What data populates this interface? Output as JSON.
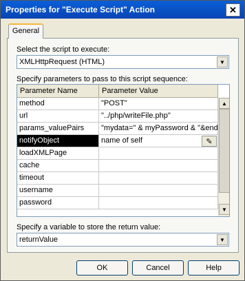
{
  "window": {
    "title": "Properties for \"Execute Script\" Action"
  },
  "tabs": [
    {
      "label": "General"
    }
  ],
  "script": {
    "label": "Select the script to execute:",
    "value": "XMLHttpRequest (HTML)"
  },
  "params": {
    "label": "Specify parameters to pass to this script sequence:",
    "headers": [
      "Parameter Name",
      "Parameter Value"
    ],
    "rows": [
      {
        "name": "method",
        "value": "\"POST\""
      },
      {
        "name": "url",
        "value": "\"../php/writeFile.php\""
      },
      {
        "name": "params_valuePairs",
        "value": "\"mydata=\" & myPassword & \"&end"
      },
      {
        "name": "notifyObject",
        "value": "name of self",
        "selected": true
      },
      {
        "name": "loadXMLPage",
        "value": ""
      },
      {
        "name": "cache",
        "value": ""
      },
      {
        "name": "timeout",
        "value": ""
      },
      {
        "name": "username",
        "value": ""
      },
      {
        "name": "password",
        "value": ""
      }
    ]
  },
  "return_var": {
    "label": "Specify a variable to store the return value:",
    "value": "returnValue"
  },
  "buttons": {
    "ok": "OK",
    "cancel": "Cancel",
    "help": "Help"
  },
  "icons": {
    "close": "close-icon",
    "dropdown": "chevron-down-icon",
    "edit": "edit-icon"
  }
}
